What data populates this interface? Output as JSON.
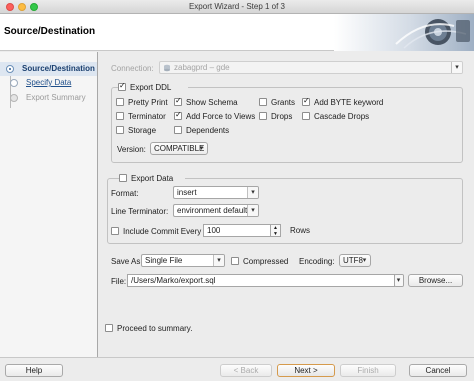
{
  "window": {
    "title": "Export Wizard - Step 1 of 3"
  },
  "header": {
    "title": "Source/Destination"
  },
  "steps": [
    {
      "label": "Source/Destination"
    },
    {
      "label": "Specify Data"
    },
    {
      "label": "Export Summary"
    }
  ],
  "connection": {
    "label": "Connection:",
    "value": "zabagprd – gde"
  },
  "export_ddl": {
    "label": "Export DDL",
    "checked": true,
    "options": [
      {
        "label": "Pretty Print",
        "checked": false
      },
      {
        "label": "Show Schema",
        "checked": true
      },
      {
        "label": "Grants",
        "checked": false
      },
      {
        "label": "Add BYTE keyword",
        "checked": true
      },
      {
        "label": "Terminator",
        "checked": false
      },
      {
        "label": "Add Force to Views",
        "checked": true
      },
      {
        "label": "Drops",
        "checked": false
      },
      {
        "label": "Cascade Drops",
        "checked": false
      },
      {
        "label": "Storage",
        "checked": false
      },
      {
        "label": "Dependents",
        "checked": false
      }
    ],
    "version_label": "Version:",
    "version_value": "COMPATIBLE"
  },
  "export_data": {
    "label": "Export Data",
    "checked": false,
    "format_label": "Format:",
    "format_value": "insert",
    "terminator_label": "Line Terminator:",
    "terminator_value": "environment default",
    "commit_label": "Include Commit Every",
    "commit_value": "100",
    "rows_label": "Rows"
  },
  "save_as": {
    "label": "Save As",
    "value": "Single File",
    "compressed_label": "Compressed",
    "encoding_label": "Encoding:",
    "encoding_value": "UTF8"
  },
  "file": {
    "label": "File:",
    "value": "/Users/Marko/export.sql",
    "browse_label": "Browse..."
  },
  "proceed": {
    "label": "Proceed to summary."
  },
  "footer": {
    "help": "Help",
    "back": "< Back",
    "next": "Next >",
    "finish": "Finish",
    "cancel": "Cancel"
  }
}
